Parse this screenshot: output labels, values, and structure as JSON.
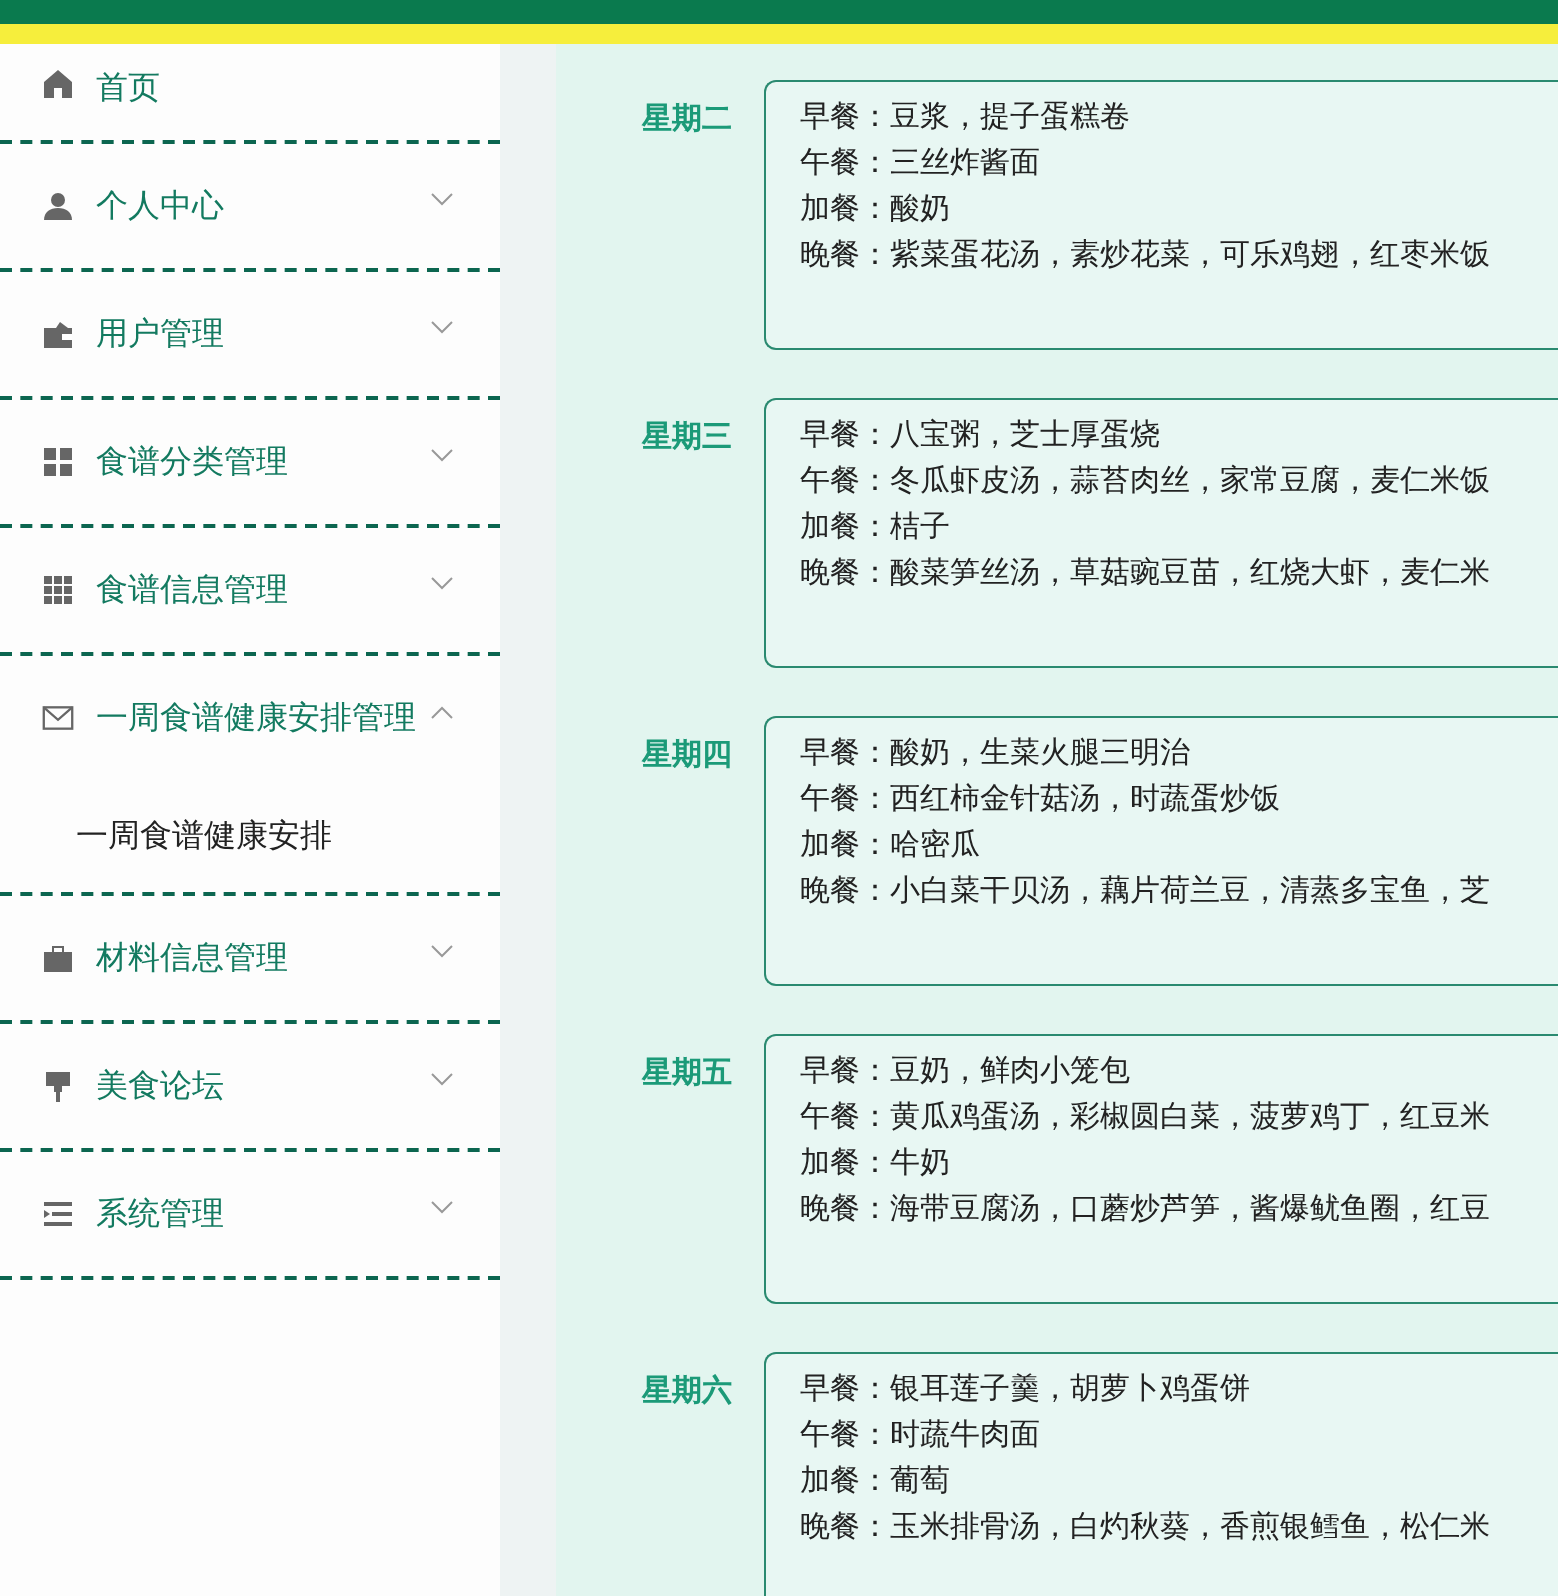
{
  "sidebar": {
    "items": [
      {
        "label": "首页",
        "kind": "link"
      },
      {
        "label": "个人中心",
        "kind": "submenu",
        "expanded": false
      },
      {
        "label": "用户管理",
        "kind": "submenu",
        "expanded": false
      },
      {
        "label": "食谱分类管理",
        "kind": "submenu",
        "expanded": false
      },
      {
        "label": "食谱信息管理",
        "kind": "submenu",
        "expanded": false
      },
      {
        "label": "一周食谱健康安排管理",
        "kind": "submenu",
        "expanded": true,
        "children": [
          {
            "label": "一周食谱健康安排"
          }
        ]
      },
      {
        "label": "材料信息管理",
        "kind": "submenu",
        "expanded": false
      },
      {
        "label": "美食论坛",
        "kind": "submenu",
        "expanded": false
      },
      {
        "label": "系统管理",
        "kind": "submenu",
        "expanded": false
      }
    ]
  },
  "days": [
    {
      "day": "星期二",
      "meals": [
        "早餐：豆浆，提子蛋糕卷",
        "午餐：三丝炸酱面",
        "加餐：酸奶",
        "晚餐：紫菜蛋花汤，素炒花菜，可乐鸡翅，红枣米饭"
      ]
    },
    {
      "day": "星期三",
      "meals": [
        "早餐：八宝粥，芝士厚蛋烧",
        "午餐：冬瓜虾皮汤，蒜苔肉丝，家常豆腐，麦仁米饭",
        "加餐：桔子",
        "晚餐：酸菜笋丝汤，草菇豌豆苗，红烧大虾，麦仁米"
      ]
    },
    {
      "day": "星期四",
      "meals": [
        "早餐：酸奶，生菜火腿三明治",
        "午餐：西红柿金针菇汤，时蔬蛋炒饭",
        "加餐：哈密瓜",
        "晚餐：小白菜干贝汤，藕片荷兰豆，清蒸多宝鱼，芝"
      ]
    },
    {
      "day": "星期五",
      "meals": [
        "早餐：豆奶，鲜肉小笼包",
        "午餐：黄瓜鸡蛋汤，彩椒圆白菜，菠萝鸡丁，红豆米",
        "加餐：牛奶",
        "晚餐：海带豆腐汤，口蘑炒芦笋，酱爆鱿鱼圈，红豆"
      ]
    },
    {
      "day": "星期六",
      "meals": [
        "早餐：银耳莲子羹，胡萝卜鸡蛋饼",
        "午餐：时蔬牛肉面",
        "加餐：葡萄",
        "晚餐：玉米排骨汤，白灼秋葵，香煎银鳕鱼，松仁米"
      ]
    }
  ]
}
